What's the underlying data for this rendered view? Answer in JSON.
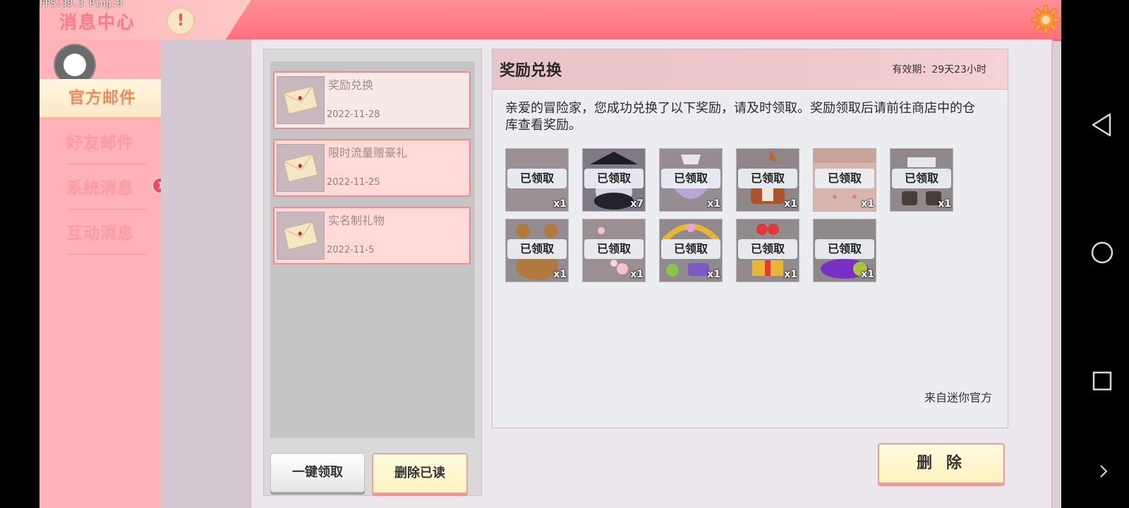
{
  "status": {
    "fps_text": "FPS:30.3  Ping:0"
  },
  "header": {
    "title": "消息中心",
    "warning_symbol": "!"
  },
  "sidebar": {
    "tabs": [
      {
        "label": "官方邮件",
        "active": true
      },
      {
        "label": "好友邮件",
        "active": false
      },
      {
        "label": "系统消息",
        "active": false
      },
      {
        "label": "互动消息",
        "active": false,
        "badge": "1"
      }
    ]
  },
  "mail_list": {
    "items": [
      {
        "title": "奖励兑换",
        "date": "2022-11-28",
        "selected": true
      },
      {
        "title": "限时流量赠豪礼",
        "date": "2022-11-25",
        "selected": false
      },
      {
        "title": "实名制礼物",
        "date": "2022-11-5",
        "selected": false
      }
    ],
    "claim_all_label": "一键领取",
    "delete_read_label": "删除已读"
  },
  "detail": {
    "title": "奖励兑换",
    "validity": "有效期：29天23小时",
    "message": "亲爱的冒险家，您成功兑换了以下奖励，请及时领取。奖励领取后请前往商店中的仓库查看奖励。",
    "claimed_label": "已领取",
    "rewards": [
      {
        "icon": "item-icon",
        "qty": "x1"
      },
      {
        "icon": "hat-character-icon",
        "qty": "x7"
      },
      {
        "icon": "skirt-icon",
        "qty": "x1"
      },
      {
        "icon": "fox-costume-icon",
        "qty": "x1"
      },
      {
        "icon": "skin-icon",
        "qty": "x1"
      },
      {
        "icon": "boots-icon",
        "qty": "x1"
      },
      {
        "icon": "bear-icon",
        "qty": "x1"
      },
      {
        "icon": "sakura-icon",
        "qty": "x1"
      },
      {
        "icon": "crown-frame-icon",
        "qty": "x1"
      },
      {
        "icon": "gift-box-icon",
        "qty": "x1"
      },
      {
        "icon": "purple-pillow-icon",
        "qty": "x1"
      }
    ],
    "sender": "来自迷你官方",
    "delete_label": "删 除"
  },
  "colors": {
    "accent": "#ff7a88",
    "topbar": "#ff8f98",
    "badge": "#ec4a62"
  }
}
